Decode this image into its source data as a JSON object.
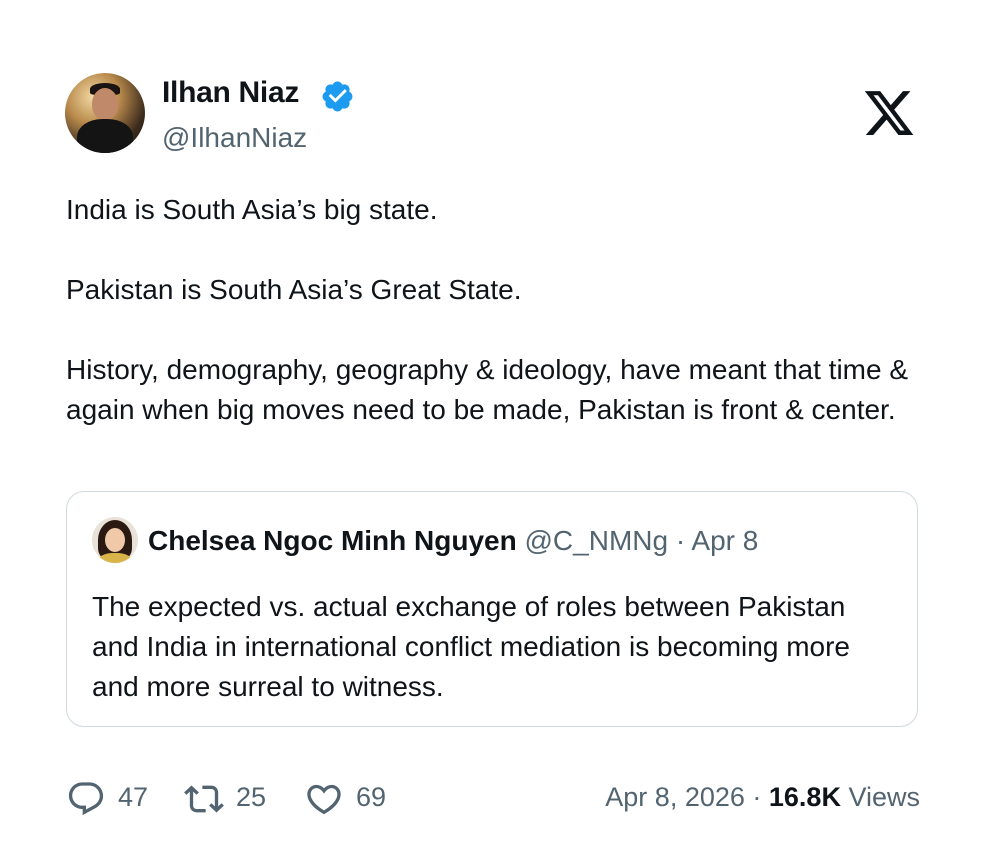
{
  "author": {
    "name": "Ilhan Niaz",
    "handle": "@IlhanNiaz",
    "verified": true
  },
  "platform_logo": "x-logo-icon",
  "tweet": {
    "paragraphs": [
      "India is South Asia’s big state.",
      "Pakistan is South Asia’s Great State.",
      "History, demography, geography & ideology, have meant that time & again when big moves need to be made, Pakistan is front & center."
    ]
  },
  "quoted_tweet": {
    "name": "Chelsea Ngoc Minh Nguyen",
    "handle": "@C_NMNg",
    "separator": " · ",
    "date": "Apr 8",
    "text": "The expected vs. actual exchange of roles between Pakistan and India in international conflict mediation is becoming more and more surreal to witness."
  },
  "engagement": {
    "replies": "47",
    "reposts": "25",
    "likes": "69"
  },
  "meta": {
    "date": "Apr 8, 2026",
    "separator": " · ",
    "views_count": "16.8K",
    "views_label": " Views"
  },
  "colors": {
    "text": "#0f1419",
    "secondary": "#536471",
    "verified_badge": "#1d9bf0",
    "border": "#cfd9de"
  }
}
